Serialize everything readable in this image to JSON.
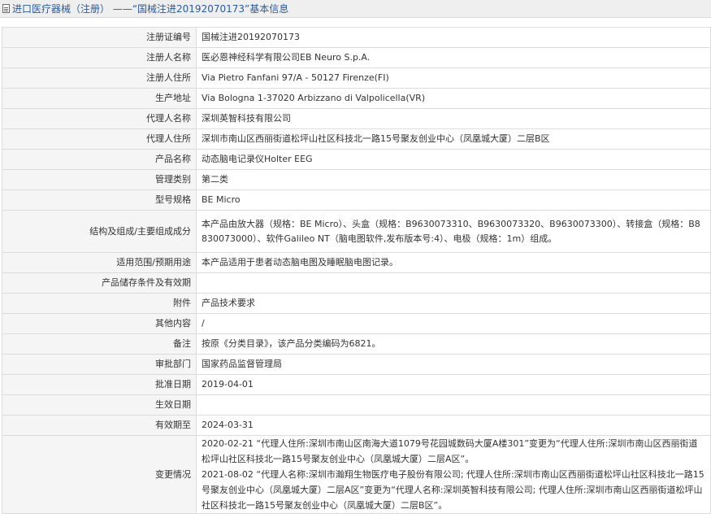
{
  "header": {
    "title": "进口医疗器械（注册） ——“国械注进20192070173”基本信息"
  },
  "rows": [
    {
      "label": "注册证编号",
      "value": "国械注进20192070173"
    },
    {
      "label": "注册人名称",
      "value": "医必恩神经科学有限公司EB Neuro S.p.A."
    },
    {
      "label": "注册人住所",
      "value": "Via Pietro Fanfani 97/A - 50127 Firenze(FI)"
    },
    {
      "label": "生产地址",
      "value": "Via Bologna 1-37020 Arbizzano di Valpolicella(VR)"
    },
    {
      "label": "代理人名称",
      "value": "深圳英智科技有限公司"
    },
    {
      "label": "代理人住所",
      "value": "深圳市南山区西丽街道松坪山社区科技北一路15号聚友创业中心（凤凰城大厦）二层B区"
    },
    {
      "label": "产品名称",
      "value": "动态脑电记录仪Holter EEG"
    },
    {
      "label": "管理类别",
      "value": "第二类"
    },
    {
      "label": "型号规格",
      "value": "BE Micro"
    },
    {
      "label": "结构及组成/主要组成成分",
      "value": "本产品由放大器（规格：BE Micro）、头盒（规格：B9630073310、B9630073320、B9630073300）、转接盒（规格：B8830073000）、软件Galileo NT（脑电图软件,发布版本号:4）、电极（规格：1m）组成。"
    },
    {
      "label": "适用范围/预期用途",
      "value": "本产品适用于患者动态脑电图及睡眠脑电图记录。"
    },
    {
      "label": "产品储存条件及有效期",
      "value": ""
    },
    {
      "label": "附件",
      "value": "产品技术要求"
    },
    {
      "label": "其他内容",
      "value": "/"
    },
    {
      "label": "备注",
      "value": "按原《分类目录》，该产品分类编码为6821。"
    },
    {
      "label": "审批部门",
      "value": "国家药品监督管理局"
    },
    {
      "label": "批准日期",
      "value": "2019-04-01"
    },
    {
      "label": "生效日期",
      "value": ""
    },
    {
      "label": "有效期至",
      "value": "2024-03-31"
    }
  ],
  "change": {
    "label": "变更情况",
    "entries": [
      "2020-02-21 “代理人住所:深圳市南山区南海大道1079号花园城数码大厦A楼301”变更为“代理人住所:深圳市南山区西丽街道松坪山社区科技北一路15号聚友创业中心（凤凰城大厦）二层A区”。",
      "2021-08-02 “代理人名称:深圳市瀚翔生物医疗电子股份有限公司; 代理人住所:深圳市南山区西丽街道松坪山社区科技北一路15号聚友创业中心（凤凰城大厦）二层A区”变更为“代理人名称:深圳英智科技有限公司; 代理人住所:深圳市南山区西丽街道松坪山社区科技北一路15号聚友创业中心（凤凰城大厦）二层B区”。"
    ]
  }
}
